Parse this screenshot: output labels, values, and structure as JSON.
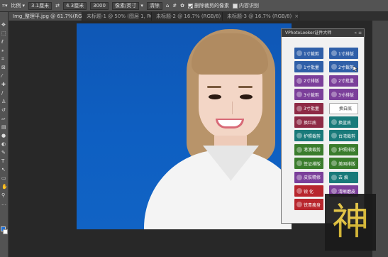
{
  "options_bar": {
    "ratio_label": "比例",
    "field1": "3.1厘米",
    "field2": "4.3厘米",
    "field3": "3000",
    "resolution_label": "像素/英寸",
    "clear_label": "清除",
    "delete_cropped_label": "删除裁剪的像素",
    "content_aware_label": "内容识别"
  },
  "tabs": [
    {
      "label": "Img_整理平.jpg @ 61.7%(RGB/8)*",
      "active": true
    },
    {
      "label": "未标题-1 @ 50% (图层 1, RGB/8)",
      "active": false
    },
    {
      "label": "未标题-2 @ 16.7% (RGB/8)",
      "active": false
    },
    {
      "label": "未标题-3 @ 16.7% (RGB/8)",
      "active": false
    }
  ],
  "plugin": {
    "title": "VPhotoLooker证件大师",
    "buttons": [
      {
        "label": "1寸裁剪",
        "color": "b-blue"
      },
      {
        "label": "1寸排版",
        "color": "b-blue"
      },
      {
        "label": "1寸批量",
        "color": "b-blue"
      },
      {
        "label": "2寸裁剪",
        "color": "b-blue"
      },
      {
        "label": "2寸排版",
        "color": "b-purple"
      },
      {
        "label": "2寸批量",
        "color": "b-purple"
      },
      {
        "label": "3寸裁剪",
        "color": "b-purple"
      },
      {
        "label": "3寸排版",
        "color": "b-purple"
      },
      {
        "label": "3寸批量",
        "color": "b-maroon"
      },
      {
        "label": "换白底",
        "color": "b-white"
      },
      {
        "label": "换红底",
        "color": "b-maroon"
      },
      {
        "label": "换蓝底",
        "color": "b-teal"
      },
      {
        "label": "护照裁剪",
        "color": "b-teal"
      },
      {
        "label": "台湾裁剪",
        "color": "b-teal"
      },
      {
        "label": "港澳裁剪",
        "color": "b-green"
      },
      {
        "label": "护照排版",
        "color": "b-green"
      },
      {
        "label": "签证排版",
        "color": "b-green"
      },
      {
        "label": "美国排版",
        "color": "b-green"
      },
      {
        "label": "皮肤精修",
        "color": "b-purple"
      },
      {
        "label": "去 痕",
        "color": "b-teal"
      },
      {
        "label": "锐 化",
        "color": "b-red"
      },
      {
        "label": "清晰磨皮",
        "color": "b-purple"
      },
      {
        "label": "铁青瘦身",
        "color": "b-red"
      }
    ]
  },
  "watermark_char": "神",
  "colors": {
    "canvas_bg": "#0f57b5",
    "fg_swatch": "#1e6fd6"
  }
}
